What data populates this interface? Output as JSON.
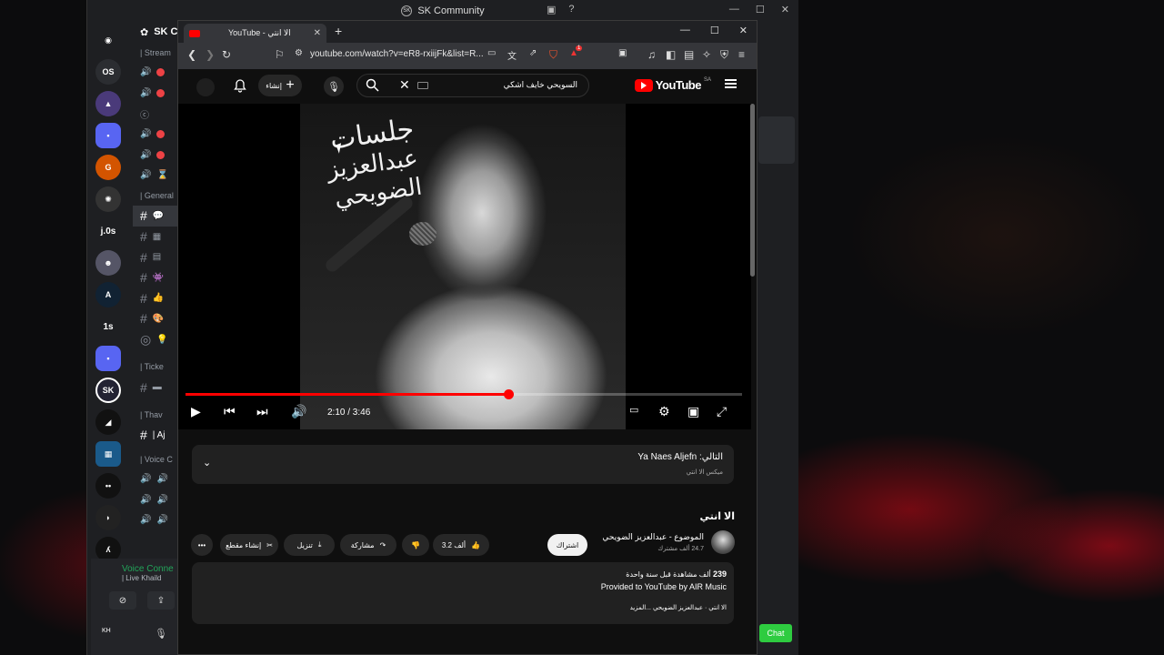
{
  "discord": {
    "title": "SK Community",
    "server_header": "SK C",
    "categories": [
      "| Stream",
      "| General",
      "| Ticke",
      "| Thav",
      "| Voice C"
    ],
    "channel_row_label": "| Aj",
    "guild_labels": [
      "OS",
      "j.0s",
      "1s"
    ],
    "voice": {
      "title": "Voice Conne",
      "sub": "| Live Khaild"
    },
    "user": {
      "name": "KH"
    }
  },
  "browser": {
    "tab_title": "YouTube - الا انتي",
    "url": "youtube.com/watch?v=eR8-rxiijFk&list=R...",
    "new_tab_symbol": "+",
    "ext_badge": "1"
  },
  "youtube": {
    "logo_text": "YouTube",
    "region": "SA",
    "search_query": "السويحي خايف اشكي",
    "create_label": "إنشاء",
    "player": {
      "calligraphy_line1": "جلسات",
      "calligraphy_line2": "عبدالعزيز الضويحي",
      "time": "2:10 / 3:46",
      "progress": 0.58
    },
    "next_up": {
      "title": "التالي: Ya Naes Aljefn",
      "subtitle": "ميكس الا انتي"
    },
    "video_title": "الا انتي",
    "channel": {
      "name": "الموضوع - عبدالعزيز الضويحي",
      "subs": "24.7 ألف مشترك",
      "subscribe": "اشتراك"
    },
    "actions": {
      "likes": "3.2 ألف",
      "share": "مشاركة",
      "download": "تنزيل",
      "clip": "إنشاء مقطع"
    },
    "description": {
      "views_prefix": "239",
      "views_rest": "ألف مشاهدة  قبل سنة واحدة",
      "line1": "Provided to YouTube by AIR Music",
      "line2": "الا انتي · عبدالعزيز الضويحي ...المزيد"
    }
  },
  "chat_button": "Chat",
  "colors": {
    "accent": "#ff0000",
    "discord_bg": "#1e1f22",
    "chat": "#2ecc40"
  }
}
